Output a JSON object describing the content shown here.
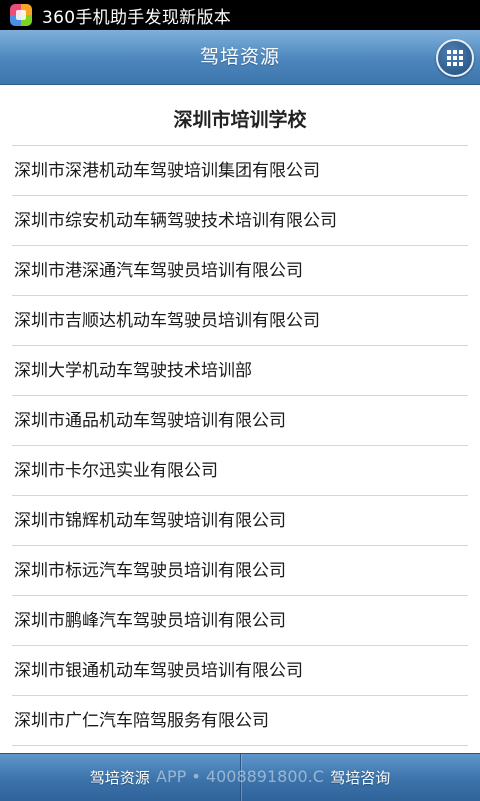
{
  "status_bar": {
    "notification_text": "360手机助手发现新版本",
    "app_icon": "360-assistant-icon"
  },
  "header": {
    "title": "驾培资源",
    "menu_icon": "grid-menu-icon"
  },
  "section": {
    "title": "深圳市培训学校"
  },
  "schools": [
    {
      "name": "深圳市深港机动车驾驶培训集团有限公司"
    },
    {
      "name": "深圳市综安机动车辆驾驶技术培训有限公司"
    },
    {
      "name": "深圳市港深通汽车驾驶员培训有限公司"
    },
    {
      "name": "深圳市吉顺达机动车驾驶员培训有限公司"
    },
    {
      "name": "深圳大学机动车驾驶技术培训部"
    },
    {
      "name": "深圳市通品机动车驾驶培训有限公司"
    },
    {
      "name": "深圳市卡尔迅实业有限公司"
    },
    {
      "name": "深圳市锦辉机动车驾驶培训有限公司"
    },
    {
      "name": "深圳市标远汽车驾驶员培训有限公司"
    },
    {
      "name": "深圳市鹏峰汽车驾驶员培训有限公司"
    },
    {
      "name": "深圳市银通机动车驾驶员培训有限公司"
    },
    {
      "name": "深圳市广仁汽车陪驾服务有限公司"
    }
  ],
  "tabs": [
    {
      "label": "驾培资源"
    },
    {
      "label": "驾培咨询"
    }
  ],
  "watermark": "APP • 4008891800.C",
  "colors": {
    "header": "#4c86bd",
    "tabbar": "#3b73aa",
    "divider": "#d6d6d6"
  }
}
